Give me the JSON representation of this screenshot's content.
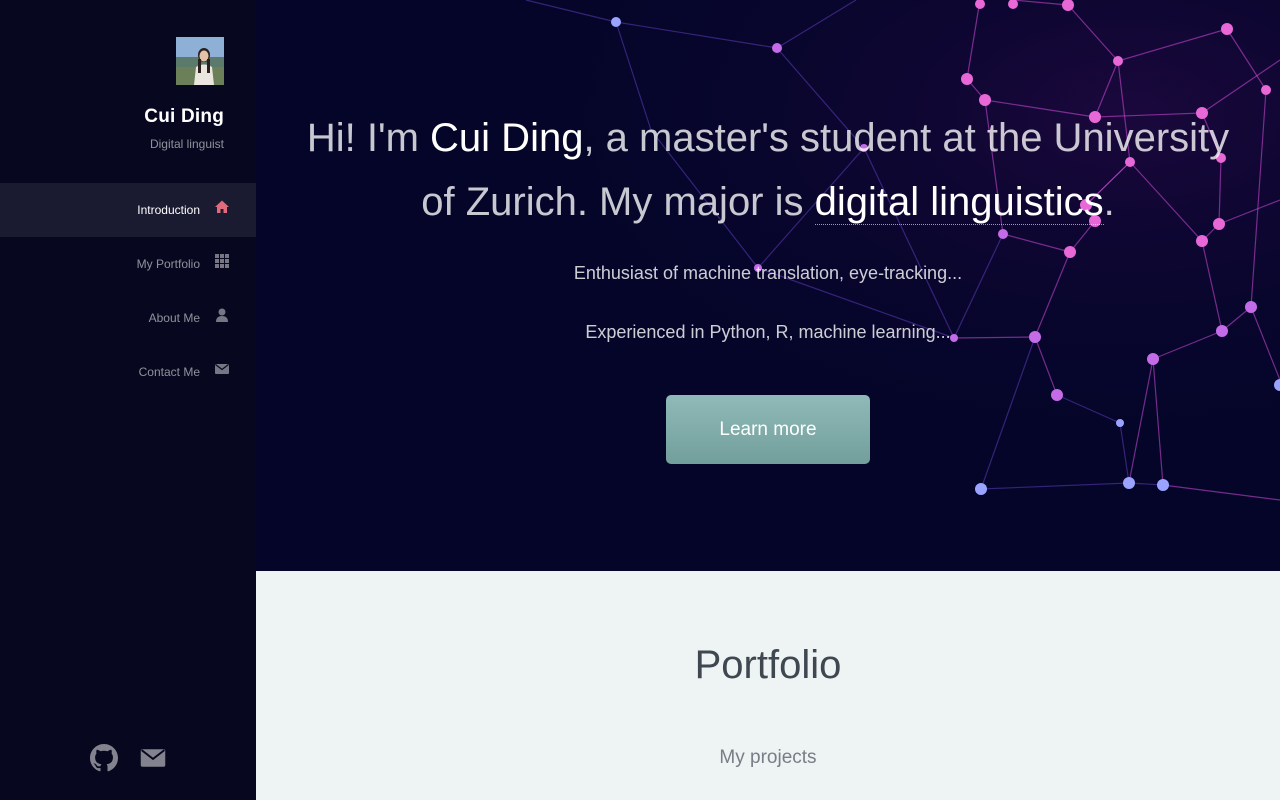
{
  "sidebar": {
    "title": "Cui Ding",
    "subtitle": "Digital linguist",
    "items": [
      {
        "label": "Introduction",
        "icon": "home-icon",
        "active": true
      },
      {
        "label": "My Portfolio",
        "icon": "grid-icon",
        "active": false
      },
      {
        "label": "About Me",
        "icon": "user-icon",
        "active": false
      },
      {
        "label": "Contact Me",
        "icon": "envelope-icon",
        "active": false
      }
    ],
    "footer_icons": [
      "github-icon",
      "envelope-icon"
    ]
  },
  "hero": {
    "heading_pre": "Hi! I'm ",
    "heading_name": "Cui Ding",
    "heading_mid": ", a master's student at the University of Zurich. My major is ",
    "heading_major": "digital linguistics",
    "heading_post": ".",
    "line1": "Enthusiast of machine translation, eye-tracking...",
    "line2": "Experienced in Python, R, machine learning...",
    "button_label": "Learn more"
  },
  "portfolio": {
    "title": "Portfolio",
    "subtitle": "My projects"
  },
  "colors": {
    "sidebar_bg": "#07071f",
    "hero_bg": "#05052a",
    "active_item_bg": "#1a1a31",
    "home_icon": "#e06b7c",
    "button": "#7fa9a7",
    "portfolio_bg": "#eef4f4"
  }
}
